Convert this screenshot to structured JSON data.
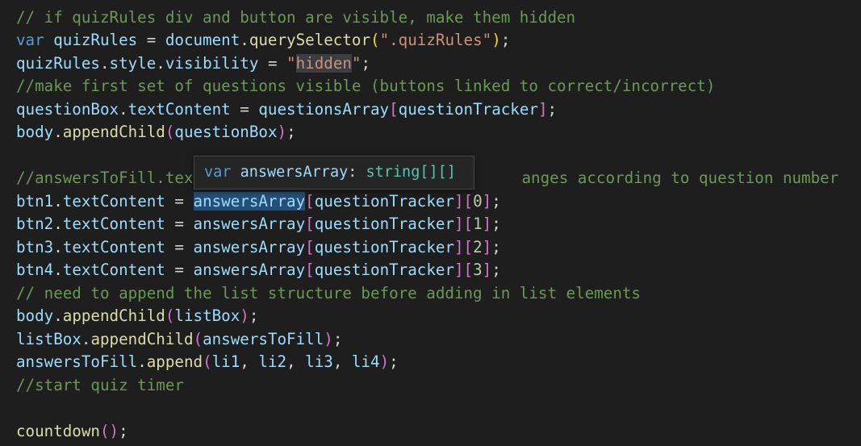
{
  "colors": {
    "background": "#1e1e1e",
    "comment": "#6a9955",
    "keyword": "#569cd6",
    "variable": "#9cdcfe",
    "function": "#dcdcaa",
    "string": "#ce9178",
    "number": "#b5cea8",
    "hover_background": "#252526"
  },
  "code": {
    "l1": "// if quizRules div and button are visible, make them hidden",
    "l2": {
      "kw": "var",
      "name": "quizRules",
      "eq": " = ",
      "obj": "document",
      "dot": ".",
      "fn": "querySelector",
      "arg": "\".quizRules\"",
      "end": ";"
    },
    "l3": {
      "obj": "quizRules",
      "prop1": "style",
      "prop2": "visibility",
      "eq": " = ",
      "q1": "\"",
      "val": "hidden",
      "q2": "\"",
      "end": ";"
    },
    "l4": "//make first set of questions visible (buttons linked to correct/incorrect)",
    "l5": {
      "obj": "questionBox",
      "prop": "textContent",
      "eq": " = ",
      "arr": "questionsArray",
      "idx": "questionTracker",
      "end": ";"
    },
    "l6": {
      "obj": "body",
      "fn": "appendChild",
      "arg": "questionBox",
      "end": ";"
    },
    "l8a": "//answersToFill.tex",
    "l8b": "anges according to question number",
    "btn_lines": [
      {
        "obj": "btn1",
        "prop": "textContent",
        "arr": "answersArray",
        "idx": "questionTracker",
        "num": "0"
      },
      {
        "obj": "btn2",
        "prop": "textContent",
        "arr": "answersArray",
        "idx": "questionTracker",
        "num": "1"
      },
      {
        "obj": "btn3",
        "prop": "textContent",
        "arr": "answersArray",
        "idx": "questionTracker",
        "num": "2"
      },
      {
        "obj": "btn4",
        "prop": "textContent",
        "arr": "answersArray",
        "idx": "questionTracker",
        "num": "3"
      }
    ],
    "l13": "// need to append the list structure before adding in list elements",
    "l14": {
      "obj": "body",
      "fn": "appendChild",
      "arg": "listBox",
      "end": ";"
    },
    "l15": {
      "obj": "listBox",
      "fn": "appendChild",
      "arg": "answersToFill",
      "end": ";"
    },
    "l16": {
      "obj": "answersToFill",
      "fn": "append",
      "a1": "li1",
      "a2": "li2",
      "a3": "li3",
      "a4": "li4",
      "end": ";"
    },
    "l17": "//start quiz timer",
    "l19": {
      "fn": "countdown",
      "end": ";"
    }
  },
  "hover": {
    "kw": "var",
    "name": "answersArray",
    "colon": ": ",
    "type": "string[][]"
  }
}
